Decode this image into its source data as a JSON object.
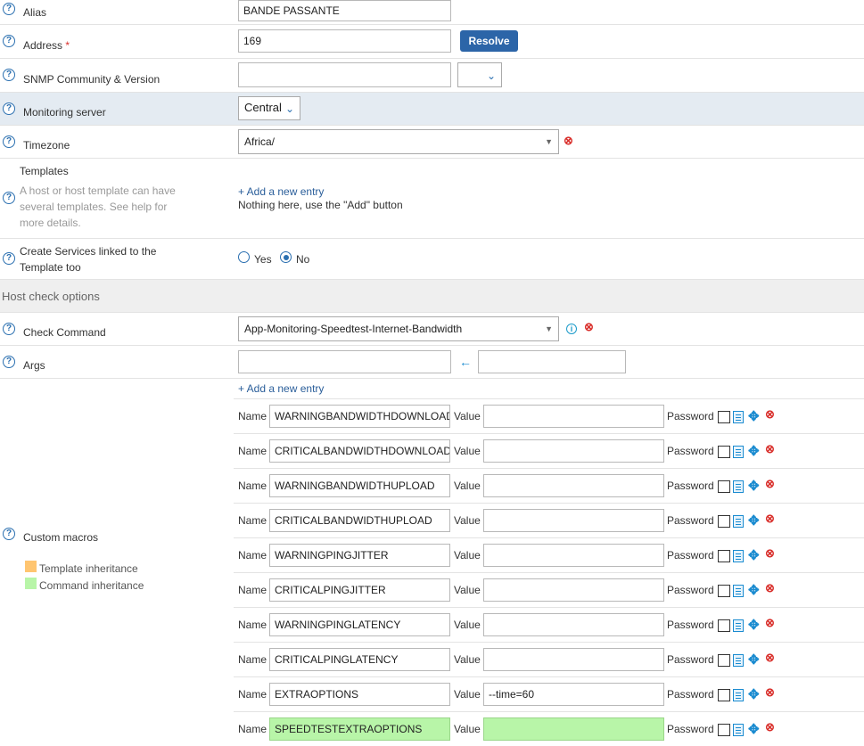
{
  "fields": {
    "alias": {
      "label": "Alias",
      "value": "BANDE PASSANTE"
    },
    "address": {
      "label": "Address",
      "required_mark": "*",
      "value": "169",
      "resolve_label": "Resolve"
    },
    "snmp": {
      "label": "SNMP Community & Version",
      "value": ""
    },
    "monitoring_server": {
      "label": "Monitoring server",
      "value": "Central"
    },
    "timezone": {
      "label": "Timezone",
      "value": "Africa/"
    },
    "templates": {
      "label": "Templates",
      "help_line1": "A host or host template can have",
      "help_line2": "several templates. See help for",
      "help_line3": "more details.",
      "add_link": "+ Add a new entry",
      "empty_text": "Nothing here, use the \"Add\" button"
    },
    "create_services": {
      "label_line1": "Create Services linked to the",
      "label_line2": "Template too",
      "yes_label": "Yes",
      "no_label": "No",
      "selected": "No"
    }
  },
  "section": {
    "title": "Host check options"
  },
  "check": {
    "command_label": "Check Command",
    "command_value": "App-Monitoring-Speedtest-Internet-Bandwidth",
    "args_label": "Args",
    "arrow": "←"
  },
  "macros": {
    "label": "Custom macros",
    "add_link": "+ Add a new entry",
    "legend_template": "Template inheritance",
    "legend_command": "Command inheritance",
    "legend_template_color": "#ffc570",
    "legend_command_color": "#b8f5a8",
    "name_label": "Name",
    "value_label": "Value",
    "password_label": "Password",
    "items": [
      {
        "name": "WARNINGBANDWIDTHDOWNLOAD",
        "value": ""
      },
      {
        "name": "CRITICALBANDWIDTHDOWNLOAD",
        "value": ""
      },
      {
        "name": "WARNINGBANDWIDTHUPLOAD",
        "value": ""
      },
      {
        "name": "CRITICALBANDWIDTHUPLOAD",
        "value": ""
      },
      {
        "name": "WARNINGPINGJITTER",
        "value": ""
      },
      {
        "name": "CRITICALPINGJITTER",
        "value": ""
      },
      {
        "name": "WARNINGPINGLATENCY",
        "value": ""
      },
      {
        "name": "CRITICALPINGLATENCY",
        "value": ""
      },
      {
        "name": "EXTRAOPTIONS",
        "value": "--time=60"
      },
      {
        "name": "SPEEDTESTEXTRAOPTIONS",
        "value": ""
      }
    ]
  },
  "icons": {
    "help": "?",
    "remove": "⊗",
    "info": "i",
    "move": "✥",
    "caret": "▼"
  }
}
